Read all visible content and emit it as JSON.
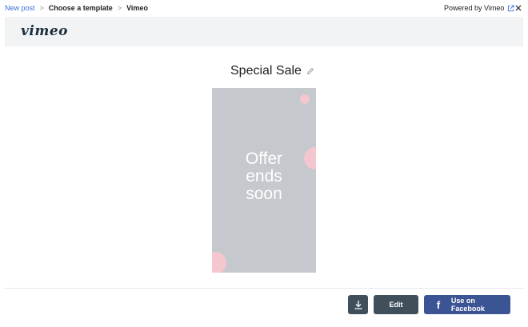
{
  "breadcrumb": {
    "items": [
      {
        "label": "New post"
      },
      {
        "label": "Choose a template"
      },
      {
        "label": "Vimeo"
      }
    ],
    "separator": ">"
  },
  "header": {
    "powered_by": "Powered by Vimeo"
  },
  "logo": {
    "text": "vimeo"
  },
  "template": {
    "title": "Special Sale",
    "preview_lines": [
      "Offer",
      "ends",
      "soon"
    ],
    "preview_bg": "#c5c8cc",
    "accent_dot_color": "#f4c7d0"
  },
  "actions": {
    "edit_label": "Edit",
    "facebook_label": "Use on Facebook",
    "facebook_icon": "f"
  },
  "colors": {
    "link": "#3b6fd6",
    "dark_button": "#3f4f5c",
    "facebook": "#3b5493"
  }
}
